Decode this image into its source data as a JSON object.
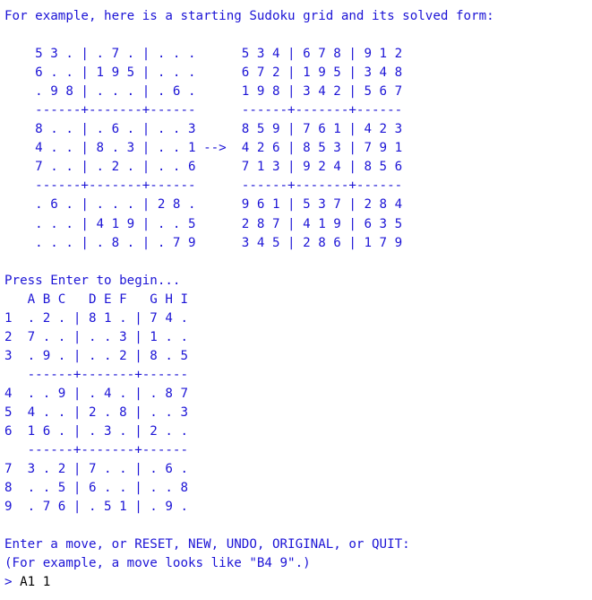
{
  "terminal": {
    "colors": {
      "output_text": "#1c14d6",
      "user_input": "#000000",
      "background": "#ffffff"
    },
    "intro": "For example, here is a starting Sudoku grid and its solved form:",
    "example_lines": [
      "    5 3 . | . 7 . | . . .      5 3 4 | 6 7 8 | 9 1 2",
      "    6 . . | 1 9 5 | . . .      6 7 2 | 1 9 5 | 3 4 8",
      "    . 9 8 | . . . | . 6 .      1 9 8 | 3 4 2 | 5 6 7",
      "    ------+-------+------      ------+-------+------",
      "    8 . . | . 6 . | . . 3      8 5 9 | 7 6 1 | 4 2 3",
      "    4 . . | 8 . 3 | . . 1 -->  4 2 6 | 8 5 3 | 7 9 1",
      "    7 . . | . 2 . | . . 6      7 1 3 | 9 2 4 | 8 5 6",
      "    ------+-------+------      ------+-------+------",
      "    . 6 . | . . . | 2 8 .      9 6 1 | 5 3 7 | 2 8 4",
      "    . . . | 4 1 9 | . . 5      2 8 7 | 4 1 9 | 6 3 5",
      "    . . . | . 8 . | . 7 9      3 4 5 | 2 8 6 | 1 7 9"
    ],
    "press_enter": "Press Enter to begin...",
    "board_lines": [
      "   A B C   D E F   G H I",
      "1  . 2 . | 8 1 . | 7 4 .",
      "2  7 . . | . . 3 | 1 . .",
      "3  . 9 . | . . 2 | 8 . 5",
      "   ------+-------+------",
      "4  . . 9 | . 4 . | . 8 7",
      "5  4 . . | 2 . 8 | . . 3",
      "6  1 6 . | . 3 . | 2 . .",
      "   ------+-------+------",
      "7  3 . 2 | 7 . . | . 6 .",
      "8  . . 5 | 6 . . | . . 8",
      "9  . 7 6 | . 5 1 | . 9 ."
    ],
    "move_prompt_line1": "Enter a move, or RESET, NEW, UNDO, ORIGINAL, or QUIT:",
    "move_prompt_line2": "(For example, a move looks like \"B4 9\".)",
    "input_prompt": "> ",
    "input_value": "A1 1"
  }
}
